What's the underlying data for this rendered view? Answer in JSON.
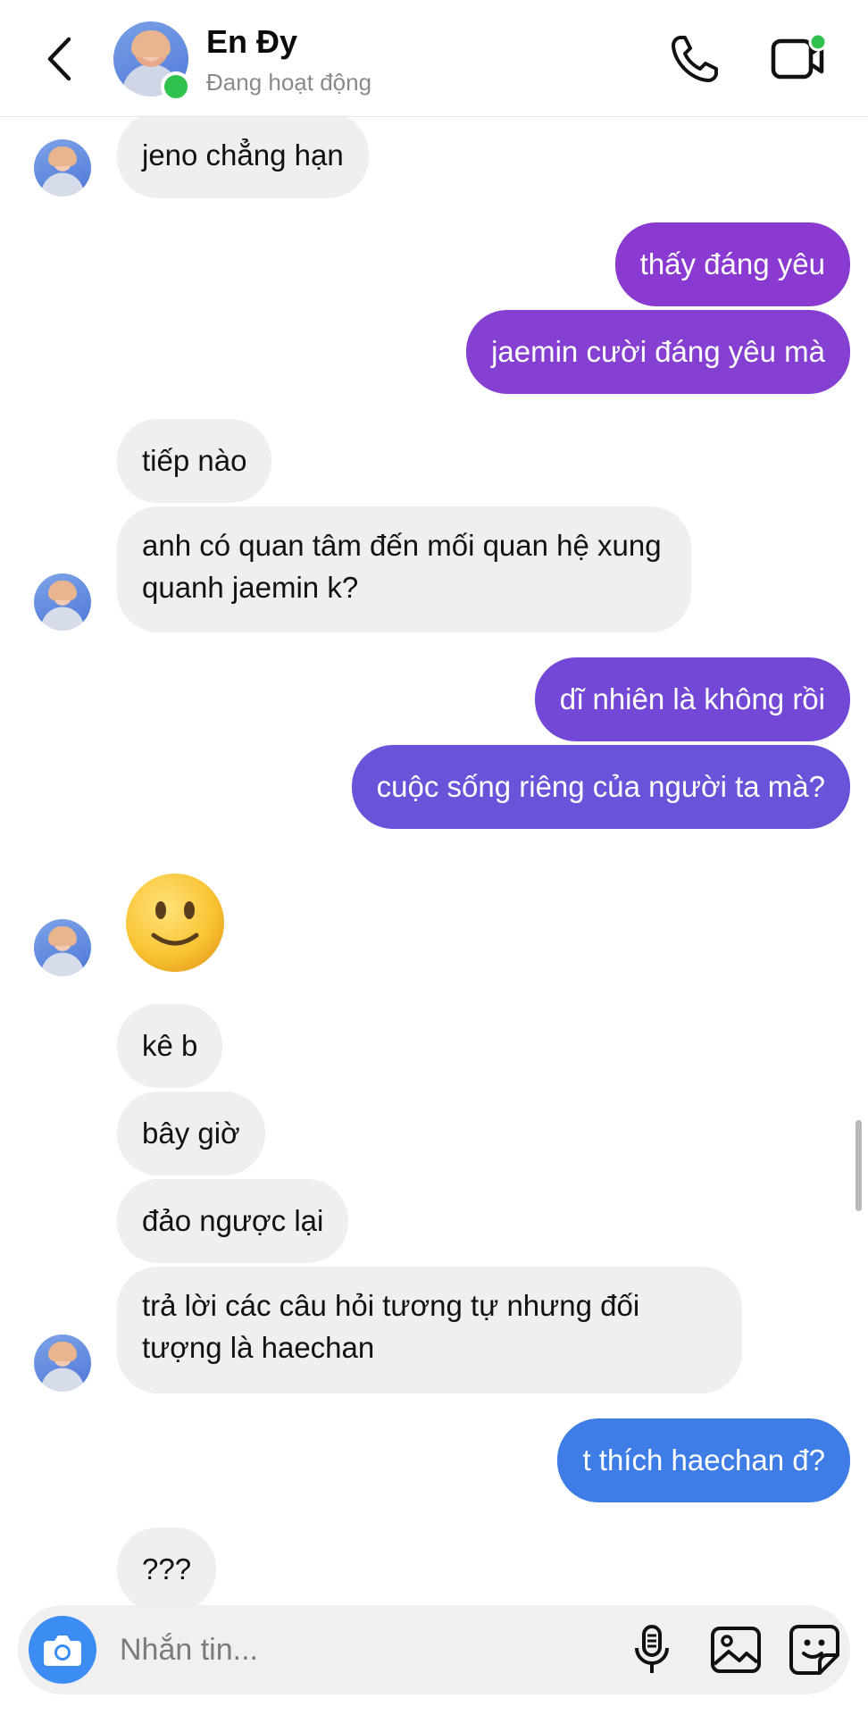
{
  "header": {
    "name": "En Đy",
    "status": "Đang hoạt động",
    "icons": {
      "back": "chevron-left-icon",
      "call": "phone-icon",
      "video": "video-camera-icon"
    }
  },
  "messages": {
    "m1": "jeno chẳng hạn",
    "m2": "thấy đáng yêu",
    "m3": "jaemin cười đáng yêu mà",
    "m4": "tiếp nào",
    "m5": "anh có quan tâm đến mối quan hệ xung quanh jaemin k?",
    "m6": "dĩ nhiên là không rồi",
    "m7": "cuộc sống riêng của người ta mà?",
    "m8_emoji": "🙂",
    "m9": "kê b",
    "m10": "bây giờ",
    "m11": "đảo ngược lại",
    "m12": "trả lời các câu hỏi tương tự nhưng đối tượng là haechan",
    "m13": "t thích haechan đ?",
    "m14": "???"
  },
  "composer": {
    "placeholder": "Nhắn tin...",
    "value": "",
    "icons": [
      "camera-icon",
      "microphone-icon",
      "gallery-icon",
      "sticker-icon"
    ]
  },
  "colors": {
    "incoming_bubble": "#efefef",
    "outgoing_purple": "#8a3ad0",
    "outgoing_violet": "#6954d9",
    "outgoing_blue": "#3e7de6",
    "online": "#31c24d",
    "camera_button": "#3b8cf3"
  }
}
